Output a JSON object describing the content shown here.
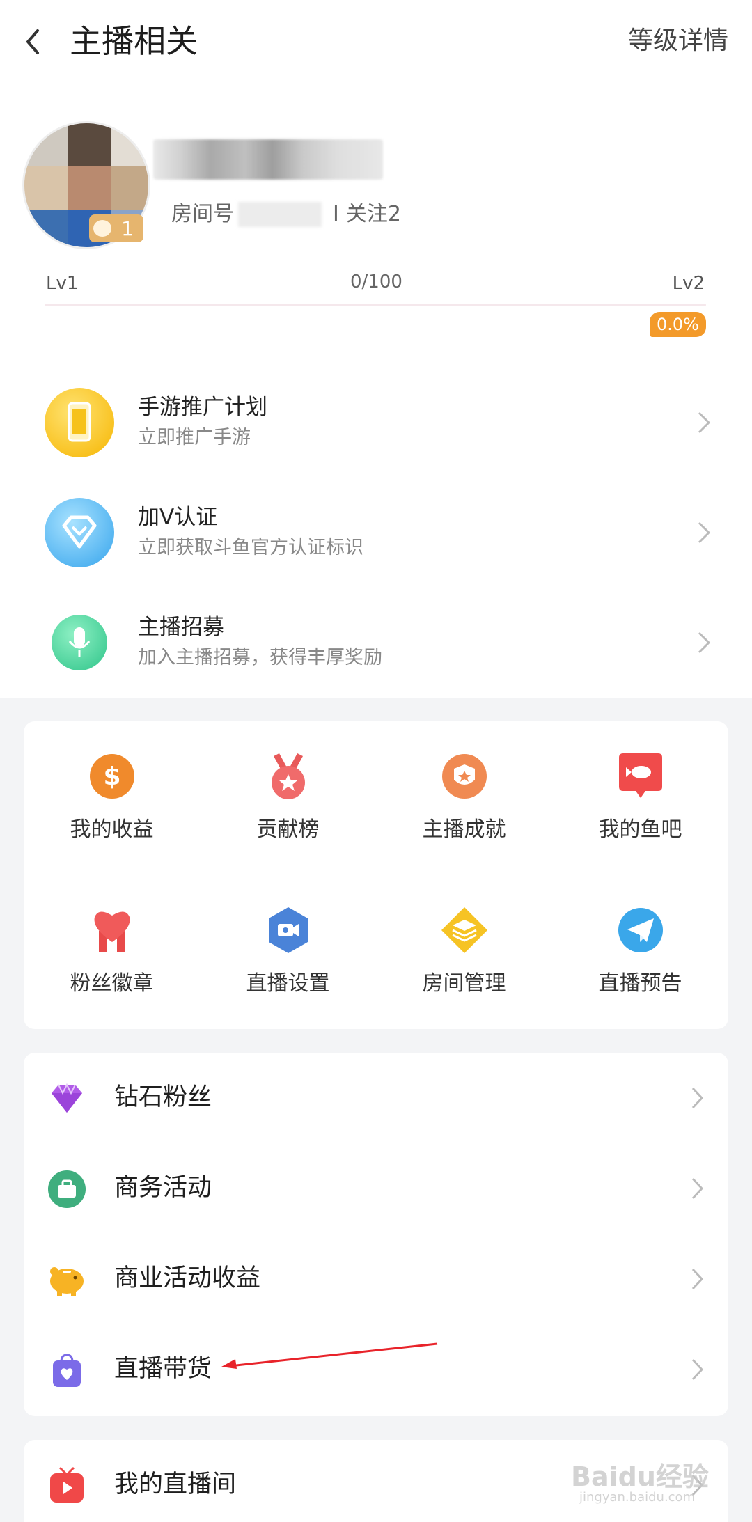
{
  "header": {
    "title": "主播相关",
    "right_link": "等级详情"
  },
  "profile": {
    "level_badge": "1",
    "room_label": "房间号",
    "separator": "I",
    "follow_text": "关注2"
  },
  "progress": {
    "start_level": "Lv1",
    "current": "0/100",
    "end_level": "Lv2",
    "percent_text": "0.0%",
    "percent_value": 0.0
  },
  "promo": [
    {
      "title": "手游推广计划",
      "subtitle": "立即推广手游",
      "icon": "phone-icon"
    },
    {
      "title": "加V认证",
      "subtitle": "立即获取斗鱼官方认证标识",
      "icon": "diamond-badge-icon"
    },
    {
      "title": "主播招募",
      "subtitle": "加入主播招募，获得丰厚奖励",
      "icon": "microphone-icon"
    }
  ],
  "grid": [
    {
      "label": "我的收益",
      "icon": "dollar-coin-icon"
    },
    {
      "label": "贡献榜",
      "icon": "medal-icon"
    },
    {
      "label": "主播成就",
      "icon": "achievement-badge-icon"
    },
    {
      "label": "我的鱼吧",
      "icon": "fish-chat-icon"
    },
    {
      "label": "粉丝徽章",
      "icon": "heart-badge-icon"
    },
    {
      "label": "直播设置",
      "icon": "camera-hexagon-icon"
    },
    {
      "label": "房间管理",
      "icon": "layers-icon"
    },
    {
      "label": "直播预告",
      "icon": "paper-plane-icon"
    }
  ],
  "list": [
    {
      "label": "钻石粉丝",
      "icon": "diamond-icon"
    },
    {
      "label": "商务活动",
      "icon": "briefcase-icon"
    },
    {
      "label": "商业活动收益",
      "icon": "piggy-bank-icon"
    },
    {
      "label": "直播带货",
      "icon": "shopping-bag-icon"
    }
  ],
  "live_room": {
    "label": "我的直播间",
    "icon": "tv-icon"
  },
  "watermark": {
    "main": "Baidu经验",
    "sub": "jingyan.baidu.com"
  },
  "colors": {
    "accent_orange": "#f39a2a",
    "background": "#f3f4f6",
    "card": "#ffffff",
    "text_primary": "#222222",
    "text_secondary": "#888888"
  }
}
